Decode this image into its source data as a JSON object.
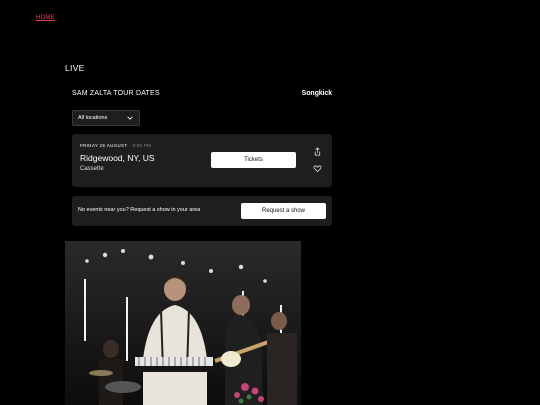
{
  "nav": {
    "home_label": "HOME"
  },
  "section": {
    "title": "LIVE"
  },
  "widget": {
    "title": "SAM ZALTA TOUR DATES",
    "brand": "Songkick",
    "location_filter": "All locations"
  },
  "event": {
    "date": "FRIDAY 28 AUGUST",
    "time": "· 9:00 PM",
    "city": "Ridgewood, NY, US",
    "venue": "Cassette",
    "tickets_label": "Tickets"
  },
  "nearby": {
    "text": "No events near you? Request a show in your area",
    "button_label": "Request a show"
  },
  "icons": {
    "share": "share-icon",
    "heart": "heart-icon",
    "chevron": "chevron-down-icon"
  },
  "colors": {
    "background": "#000000",
    "card": "#1e1e1e",
    "nav_link": "#e0445e"
  }
}
